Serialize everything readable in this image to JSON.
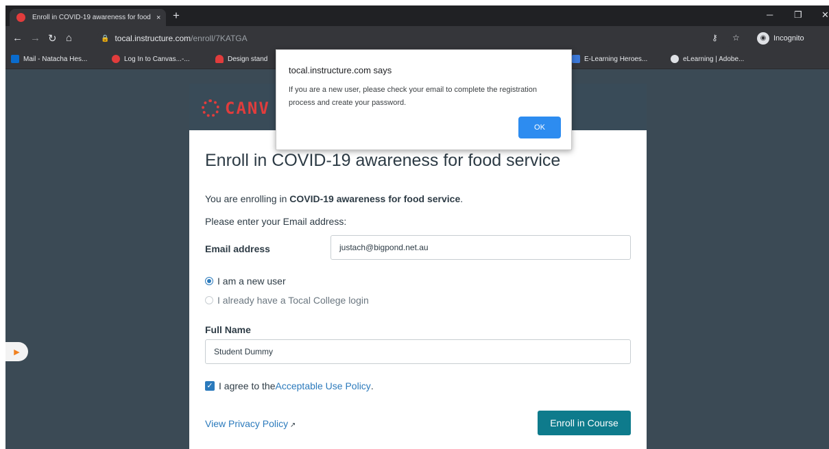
{
  "browser": {
    "tab_title": "Enroll in COVID-19 awareness for food service",
    "tab_close": "×",
    "new_tab": "+",
    "url_host": "tocal.instructure.com",
    "url_path": "/enroll/7KATGA",
    "profile": "Incognito",
    "bookmarks": [
      {
        "label": "Mail - Natacha Hes...",
        "color": "#0a6cce"
      },
      {
        "label": "Log In to Canvas...-...",
        "color": "#e13c3c"
      },
      {
        "label": "Design stand",
        "color": "#e13c3c"
      },
      {
        "label": "E-Learning Heroes...",
        "color": "#3c78d8"
      },
      {
        "label": "eLearning | Adobe...",
        "color": "#dfe1e5"
      }
    ]
  },
  "page": {
    "logo_text": "CANV",
    "title": "Enroll in COVID-19 awareness for food service",
    "enrolling_prefix": "You are enrolling in ",
    "enrolling_course": "COVID-19 awareness for food service",
    "enrolling_suffix": ".",
    "email_prompt": "Please enter your Email address:",
    "email_label": "Email address",
    "email_value": "justach@bigpond.net.au",
    "radio_new": "I am a new user",
    "radio_existing": "I already have a Tocal College login",
    "fullname_label": "Full Name",
    "fullname_value": "Student Dummy",
    "agree_prefix": "I agree to the ",
    "agree_link": "Acceptable Use Policy",
    "agree_suffix": ".",
    "privacy_link": "View Privacy Policy",
    "enroll_button": "Enroll in Course"
  },
  "dialog": {
    "title": "tocal.instructure.com says",
    "message": "If you are a new user, please check your email to complete the registration process and create your password.",
    "ok": "OK"
  },
  "colors": {
    "accent": "#2b7abc",
    "button": "#0e7b8c",
    "header": "#394b58",
    "canvas_red": "#e13c3c"
  }
}
